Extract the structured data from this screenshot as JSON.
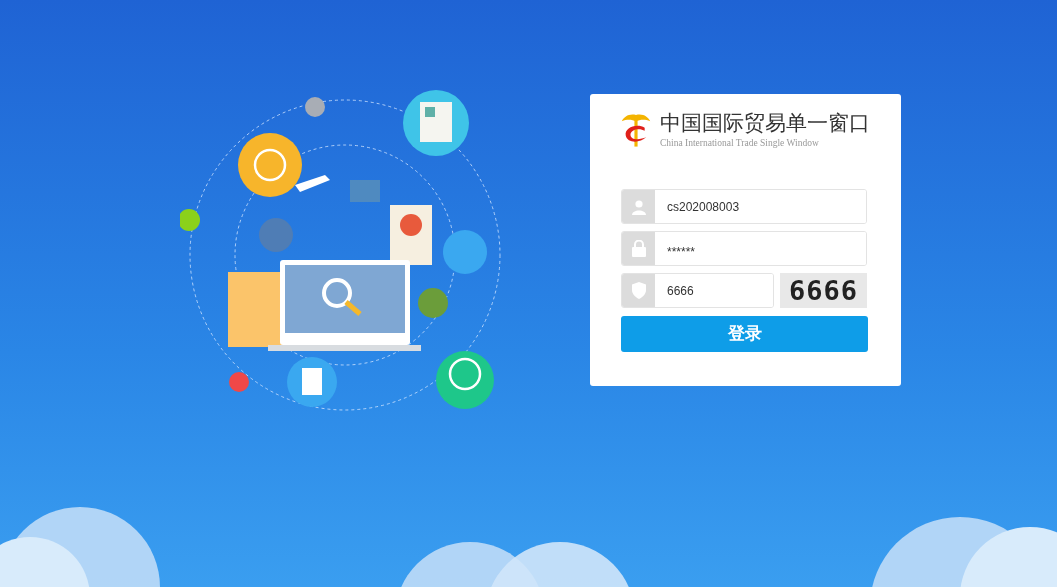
{
  "logo": {
    "title": "中国国际贸易单一窗口",
    "subtitle": "China International Trade Single Window"
  },
  "fields": [
    {
      "kind": "user",
      "value": "cs202008003"
    },
    {
      "kind": "password",
      "value": "******"
    },
    {
      "kind": "captcha",
      "value": "6666",
      "captcha_image_text": "6666"
    }
  ],
  "login_button": "登录"
}
